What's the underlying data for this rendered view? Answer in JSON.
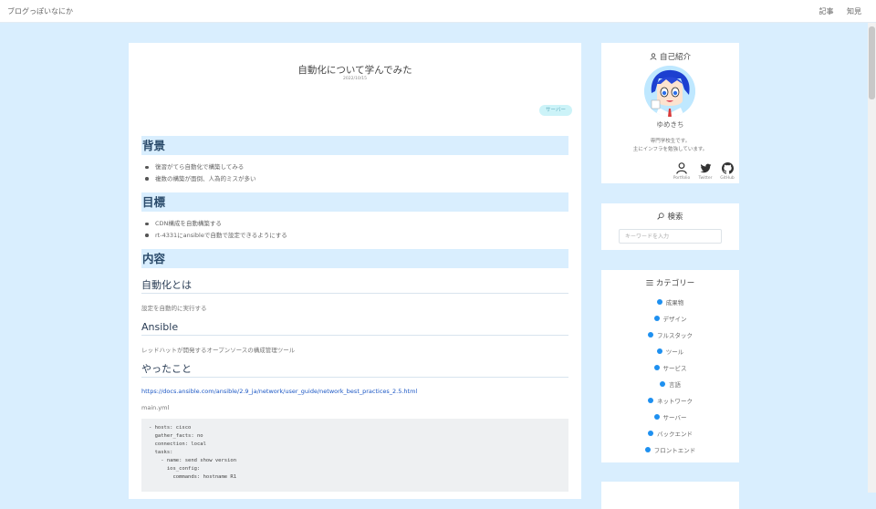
{
  "topnav": {
    "brand": "ブログっぽいなにか",
    "links": [
      {
        "label": "記事"
      },
      {
        "label": "知見"
      }
    ]
  },
  "article": {
    "title": "自動化について学んでみた",
    "date": "2022/10/15",
    "tag": "サーバー",
    "sections": {
      "background": {
        "heading": "背景",
        "items": [
          "復習がてら自動化で構築してみる",
          "複数の構築が面倒、人為的ミスが多い"
        ]
      },
      "goal": {
        "heading": "目標",
        "items": [
          "CDN構成を自動構築する",
          "rt-4331にansibleで自動で設定できるようにする"
        ]
      },
      "content": {
        "heading": "内容",
        "automation": {
          "heading": "自動化とは",
          "text": "設定を自動的に実行する"
        },
        "ansible": {
          "heading": "Ansible",
          "text": "レッドハットが開発するオープンソースの構成管理ツール"
        },
        "done": {
          "heading": "やったこと",
          "link": "https://docs.ansible.com/ansible/2.9_ja/network/user_guide/network_best_practices_2.5.html",
          "filename": "main.yml",
          "code": "- hosts: cisco\n  gather_facts: no\n  connection: local\n  tasks:\n    - name: send show version\n      ios_config:\n        commands: hostname R1"
        }
      }
    }
  },
  "sidebar": {
    "profile": {
      "title": "自己紹介",
      "name": "ゆめきち",
      "desc_line1": "専門学校生です。",
      "desc_line2": "主にインフラを勉強しています。",
      "links": [
        {
          "label": "Portfolio",
          "icon": "person-icon"
        },
        {
          "label": "Twitter",
          "icon": "twitter-icon"
        },
        {
          "label": "GitHub",
          "icon": "github-icon"
        }
      ]
    },
    "search": {
      "title": "検索",
      "placeholder": "キーワードを入力"
    },
    "categories": {
      "title": "カテゴリー",
      "items": [
        "成果物",
        "デザイン",
        "フルスタック",
        "ツール",
        "サービス",
        "言語",
        "ネットワーク",
        "サーバー",
        "バックエンド",
        "フロントエンド"
      ]
    }
  },
  "colors": {
    "accent": "#1e90f0",
    "background": "#d9eefe",
    "tag_bg": "#ccf3f8"
  }
}
